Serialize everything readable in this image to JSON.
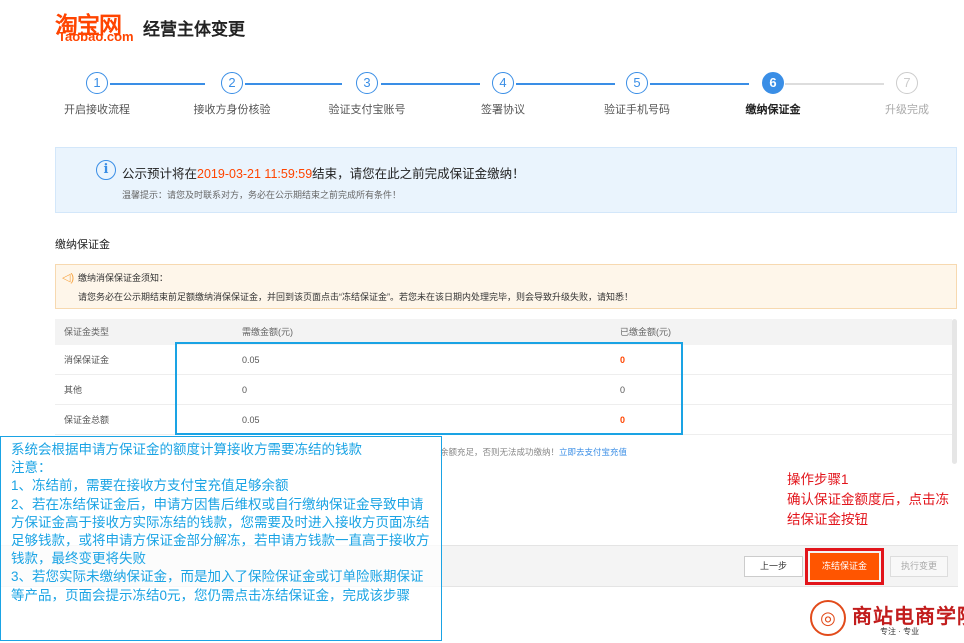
{
  "header": {
    "logo_main": "淘宝网",
    "logo_sub": "Taobao.com",
    "title": "经营主体变更"
  },
  "steps": [
    {
      "num": "1",
      "label": "开启接收流程",
      "state": "done"
    },
    {
      "num": "2",
      "label": "接收方身份核验",
      "state": "done"
    },
    {
      "num": "3",
      "label": "验证支付宝账号",
      "state": "done"
    },
    {
      "num": "4",
      "label": "签署协议",
      "state": "done"
    },
    {
      "num": "5",
      "label": "验证手机号码",
      "state": "done"
    },
    {
      "num": "6",
      "label": "缴纳保证金",
      "state": "active"
    },
    {
      "num": "7",
      "label": "升级完成",
      "state": "future"
    }
  ],
  "notice": {
    "prefix": "公示预计将在",
    "date": "2019-03-21 11:59:59",
    "suffix": "结束，请您在此之前完成保证金缴纳！",
    "tip": "温馨提示：请您及时联系对方，务必在公示期结束之前完成所有条件！"
  },
  "section_title": "缴纳保证金",
  "warning": {
    "title": "缴纳消保保证金须知：",
    "text": "请您务必在公示期结束前足额缴纳消保保证金，并回到该页面点击“冻结保证金”。若您未在该日期内处理完毕，则会导致升级失败，请知悉！"
  },
  "table": {
    "headers": [
      "保证金类型",
      "需缴金额(元)",
      "已缴金额(元)"
    ],
    "rows": [
      {
        "type": "消保保证金",
        "required": "0.05",
        "paid": "0",
        "paid_red": true
      },
      {
        "type": "其他",
        "required": "0",
        "paid": "0",
        "paid_red": false
      },
      {
        "type": "保证金总额",
        "required": "0.05",
        "paid": "0",
        "paid_red": true
      }
    ]
  },
  "recharge": {
    "text": "余额充足，否则无法成功缴纳！",
    "link": "立即去支付宝充值"
  },
  "buttons": {
    "prev": "上一步",
    "freeze": "冻结保证金",
    "execute": "执行变更"
  },
  "annotation": {
    "line1": "操作步骤1",
    "line2": "确认保证金额度后，点击冻结保证金按钮"
  },
  "note": {
    "lines": [
      "系统会根据申请方保证金的额度计算接收方需要冻结的钱款",
      "注意：",
      "1、冻结前，需要在接收方支付宝充值足够余额",
      "2、若在冻结保证金后，申请方因售后维权或自行缴纳保证金导致申请方保证金高于接收方实际冻结的钱款，您需要及时进入接收方页面冻结足够钱款，或将申请方保证金部分解冻，若申请方钱款一直高于接收方钱款，最终变更将失败",
      "3、若您实际未缴纳保证金，而是加入了保险保证金或订单险账期保证等产品，页面会提示冻结0元，您仍需点击冻结保证金，完成该步骤"
    ]
  },
  "watermark": {
    "text": "商站电商学院",
    "sub": "专注 · 专业"
  },
  "colors": {
    "brand": "#ff4400",
    "step_blue": "#3a8ee6",
    "highlight": "#1aa3e4",
    "annotation_red": "#e2141b"
  }
}
